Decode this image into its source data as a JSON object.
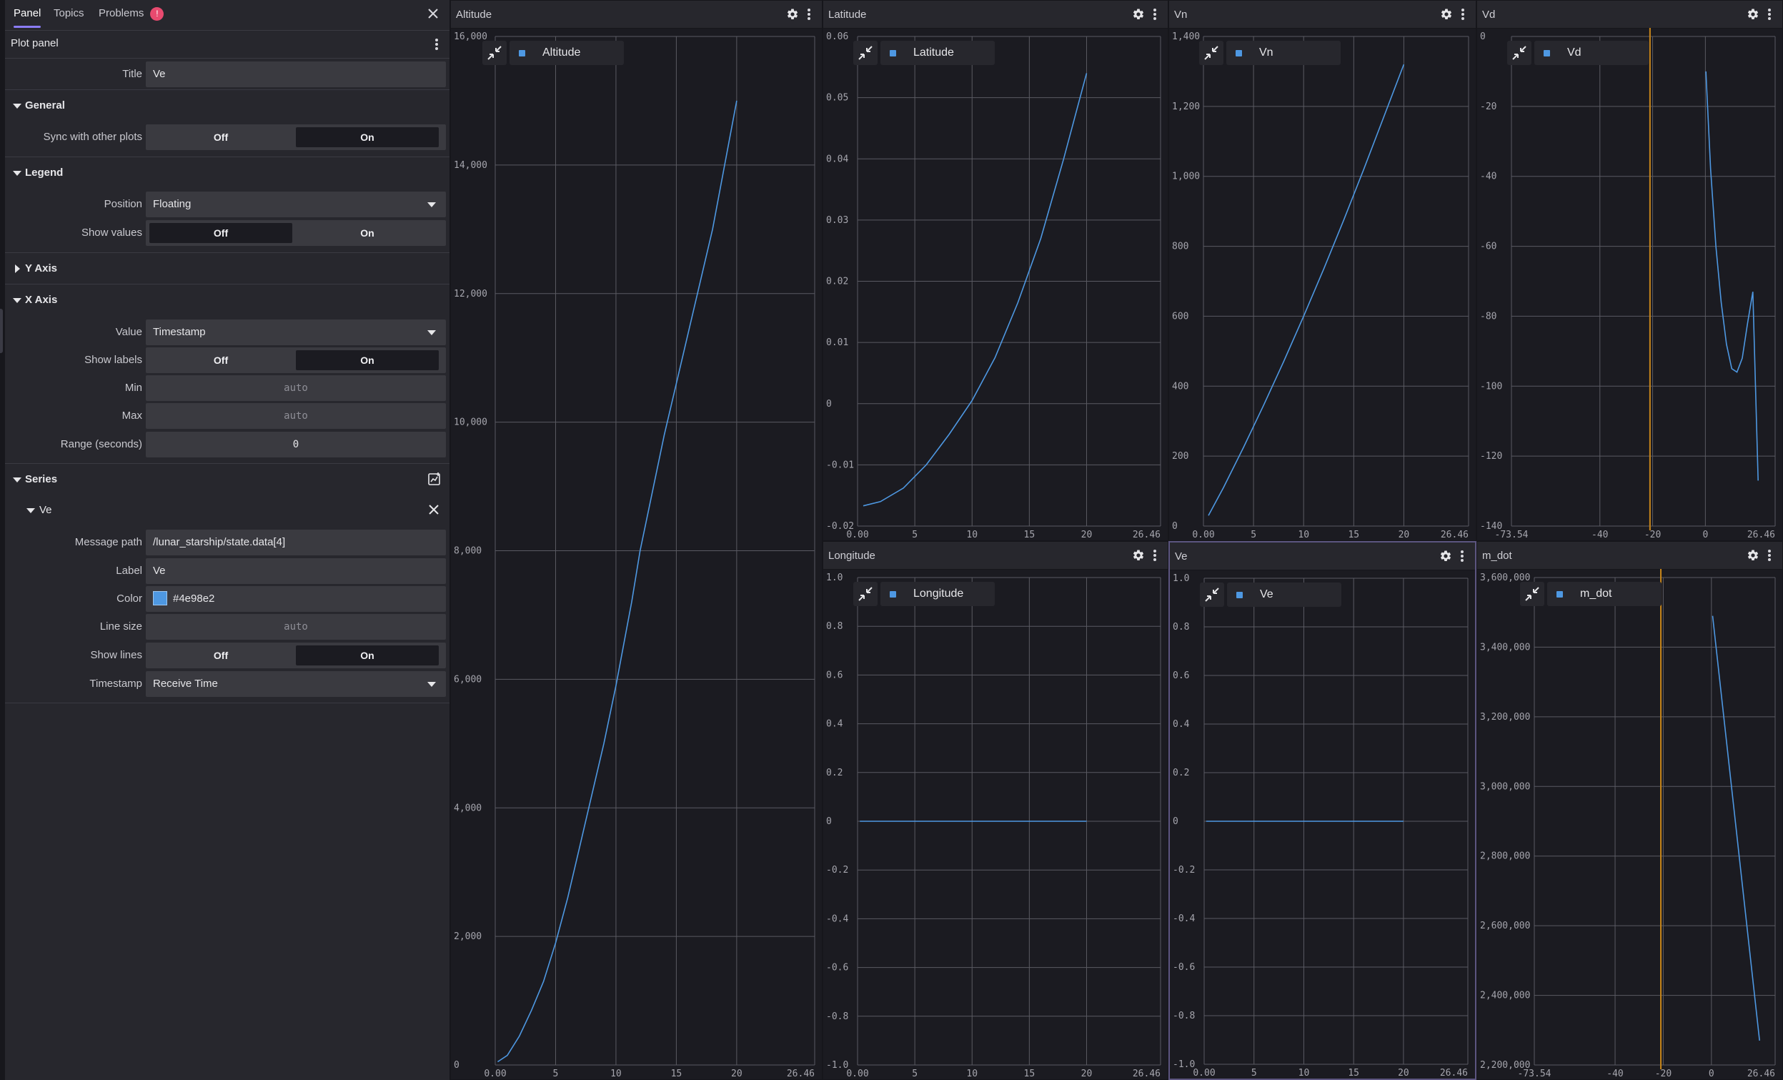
{
  "sidebar": {
    "tabs": [
      {
        "label": "Panel"
      },
      {
        "label": "Topics"
      },
      {
        "label": "Problems",
        "badge": "!"
      }
    ],
    "header_title": "Plot panel",
    "title": {
      "label": "Title",
      "value": "Ve"
    },
    "general": {
      "heading": "General",
      "sync_label": "Sync with other plots",
      "off": "Off",
      "on": "On",
      "selected": "On"
    },
    "legend": {
      "heading": "Legend",
      "position_label": "Position",
      "position_value": "Floating",
      "show_values_label": "Show values",
      "off": "Off",
      "on": "On",
      "selected": "Off"
    },
    "y_axis": {
      "heading": "Y Axis"
    },
    "x_axis": {
      "heading": "X Axis",
      "value_label": "Value",
      "value": "Timestamp",
      "show_labels_label": "Show labels",
      "off": "Off",
      "on": "On",
      "selected": "On",
      "min_label": "Min",
      "min_placeholder": "auto",
      "max_label": "Max",
      "max_placeholder": "auto",
      "range_label": "Range (seconds)",
      "range_value": "0"
    },
    "series": {
      "heading": "Series",
      "item": {
        "name": "Ve",
        "message_path_label": "Message path",
        "message_path": "/lunar_starship/state.data[4]",
        "label_label": "Label",
        "label": "Ve",
        "color_label": "Color",
        "color": "#4e98e2",
        "line_size_label": "Line size",
        "line_size_placeholder": "auto",
        "show_lines_label": "Show lines",
        "off": "Off",
        "on": "On",
        "selected": "On",
        "timestamp_label": "Timestamp",
        "timestamp": "Receive Time"
      }
    }
  },
  "colors": {
    "line": "#4e98e2",
    "marker": "#c8861a",
    "accent": "#8b7cf6",
    "badge": "#e84a6f"
  },
  "panels": [
    {
      "title": "Altitude",
      "legend": "Altitude"
    },
    {
      "title": "Latitude",
      "legend": "Latitude"
    },
    {
      "title": "Vn",
      "legend": "Vn"
    },
    {
      "title": "Vd",
      "legend": "Vd"
    },
    {
      "title": "Longitude",
      "legend": "Longitude"
    },
    {
      "title": "Ve",
      "legend": "Ve"
    },
    {
      "title": "m_dot",
      "legend": "m_dot"
    }
  ],
  "chart_data": [
    {
      "type": "line",
      "title": "Altitude",
      "xlim": [
        0,
        26.46
      ],
      "xticks": [
        "0.00",
        "5",
        "10",
        "15",
        "20",
        "26.46"
      ],
      "xtick_values": [
        0,
        5,
        10,
        15,
        20,
        26.46
      ],
      "ylim": [
        0,
        16000
      ],
      "yticks": [
        "0",
        "2,000",
        "4,000",
        "6,000",
        "8,000",
        "10,000",
        "12,000",
        "14,000",
        "16,000"
      ],
      "ytick_values": [
        0,
        2000,
        4000,
        6000,
        8000,
        10000,
        12000,
        14000,
        16000
      ],
      "series": [
        {
          "name": "Altitude",
          "x": [
            0.2,
            1,
            2,
            3,
            4,
            5,
            6,
            7,
            8,
            9,
            10,
            11,
            11.3,
            12,
            13,
            14,
            15,
            16,
            17,
            18,
            19,
            20
          ],
          "y": [
            50,
            150,
            450,
            850,
            1300,
            1900,
            2600,
            3400,
            4200,
            5000,
            5900,
            6900,
            7200,
            8000,
            8900,
            9800,
            10600,
            11400,
            12200,
            13000,
            14000,
            15000
          ]
        }
      ]
    },
    {
      "type": "line",
      "title": "Latitude",
      "xlim": [
        0,
        26.46
      ],
      "xticks": [
        "0.00",
        "5",
        "10",
        "15",
        "20",
        "26.46"
      ],
      "xtick_values": [
        0,
        5,
        10,
        15,
        20,
        26.46
      ],
      "ylim": [
        -0.02,
        0.06
      ],
      "yticks": [
        "-0.02",
        "-0.01",
        "0",
        "0.01",
        "0.02",
        "0.03",
        "0.04",
        "0.05",
        "0.06"
      ],
      "ytick_values": [
        -0.02,
        -0.01,
        0,
        0.01,
        0.02,
        0.03,
        0.04,
        0.05,
        0.06
      ],
      "series": [
        {
          "name": "Latitude",
          "x": [
            0.5,
            2,
            4,
            6,
            8,
            10,
            12,
            14,
            16,
            18,
            20
          ],
          "y": [
            -0.0167,
            -0.016,
            -0.0138,
            -0.01,
            -0.005,
            0.0005,
            0.0075,
            0.0165,
            0.027,
            0.04,
            0.054
          ]
        }
      ]
    },
    {
      "type": "line",
      "title": "Vn",
      "xlim": [
        0,
        26.46
      ],
      "xticks": [
        "0.00",
        "5",
        "10",
        "15",
        "20",
        "26.46"
      ],
      "xtick_values": [
        0,
        5,
        10,
        15,
        20,
        26.46
      ],
      "ylim": [
        0,
        1400
      ],
      "yticks": [
        "0",
        "200",
        "400",
        "600",
        "800",
        "1,000",
        "1,200",
        "1,400"
      ],
      "ytick_values": [
        0,
        200,
        400,
        600,
        800,
        1000,
        1200,
        1400
      ],
      "series": [
        {
          "name": "Vn",
          "x": [
            0.5,
            2,
            4,
            6,
            8,
            10,
            12,
            14,
            16,
            18,
            20
          ],
          "y": [
            30,
            110,
            225,
            345,
            470,
            600,
            735,
            875,
            1020,
            1170,
            1320
          ]
        }
      ]
    },
    {
      "type": "line",
      "title": "Vd",
      "xlim": [
        -73.54,
        26.46
      ],
      "xticks": [
        "-73.54",
        "-40",
        "-20",
        "0",
        "26.46"
      ],
      "xtick_values": [
        -73.54,
        -40,
        -20,
        0,
        26.46
      ],
      "ylim": [
        -140,
        0
      ],
      "yticks": [
        "-140",
        "-120",
        "-100",
        "-80",
        "-60",
        "-40",
        "-20",
        "0"
      ],
      "ytick_values": [
        -140,
        -120,
        -100,
        -80,
        -60,
        -40,
        -20,
        0
      ],
      "marker_x": -21,
      "series": [
        {
          "name": "Vd",
          "x": [
            0.2,
            2,
            4,
            6,
            8,
            10,
            12,
            14,
            16,
            18,
            19,
            20
          ],
          "y": [
            -10,
            -38,
            -60,
            -76,
            -88,
            -95,
            -96,
            -92,
            -82,
            -73,
            -100,
            -127
          ]
        }
      ]
    },
    {
      "type": "line",
      "title": "Longitude",
      "xlim": [
        0,
        26.46
      ],
      "xticks": [
        "0.00",
        "5",
        "10",
        "15",
        "20",
        "26.46"
      ],
      "xtick_values": [
        0,
        5,
        10,
        15,
        20,
        26.46
      ],
      "ylim": [
        -1,
        1
      ],
      "yticks": [
        "-1.0",
        "-0.8",
        "-0.6",
        "-0.4",
        "-0.2",
        "0",
        "0.2",
        "0.4",
        "0.6",
        "0.8",
        "1.0"
      ],
      "ytick_values": [
        -1,
        -0.8,
        -0.6,
        -0.4,
        -0.2,
        0,
        0.2,
        0.4,
        0.6,
        0.8,
        1
      ],
      "series": [
        {
          "name": "Longitude",
          "x": [
            0.2,
            20
          ],
          "y": [
            0,
            0
          ]
        }
      ]
    },
    {
      "type": "line",
      "title": "Ve",
      "xlim": [
        0,
        26.46
      ],
      "xticks": [
        "0.00",
        "5",
        "10",
        "15",
        "20",
        "26.46"
      ],
      "xtick_values": [
        0,
        5,
        10,
        15,
        20,
        26.46
      ],
      "ylim": [
        -1,
        1
      ],
      "yticks": [
        "-1.0",
        "-0.8",
        "-0.6",
        "-0.4",
        "-0.2",
        "0",
        "0.2",
        "0.4",
        "0.6",
        "0.8",
        "1.0"
      ],
      "ytick_values": [
        -1,
        -0.8,
        -0.6,
        -0.4,
        -0.2,
        0,
        0.2,
        0.4,
        0.6,
        0.8,
        1
      ],
      "series": [
        {
          "name": "Ve",
          "x": [
            0.2,
            20
          ],
          "y": [
            0,
            0
          ]
        }
      ]
    },
    {
      "type": "line",
      "title": "m_dot",
      "xlim": [
        -73.54,
        26.46
      ],
      "xticks": [
        "-73.54",
        "-40",
        "-20",
        "0",
        "26.46"
      ],
      "xtick_values": [
        -73.54,
        -40,
        -20,
        0,
        26.46
      ],
      "ylim": [
        2200000,
        3600000
      ],
      "yticks": [
        "2,200,000",
        "2,400,000",
        "2,600,000",
        "2,800,000",
        "3,000,000",
        "3,200,000",
        "3,400,000",
        "3,600,000"
      ],
      "ytick_values": [
        2200000,
        2400000,
        2600000,
        2800000,
        3000000,
        3200000,
        3400000,
        3600000
      ],
      "marker_x": -21,
      "series": [
        {
          "name": "m_dot",
          "x": [
            0.5,
            20
          ],
          "y": [
            3490000,
            2270000
          ]
        }
      ]
    }
  ]
}
